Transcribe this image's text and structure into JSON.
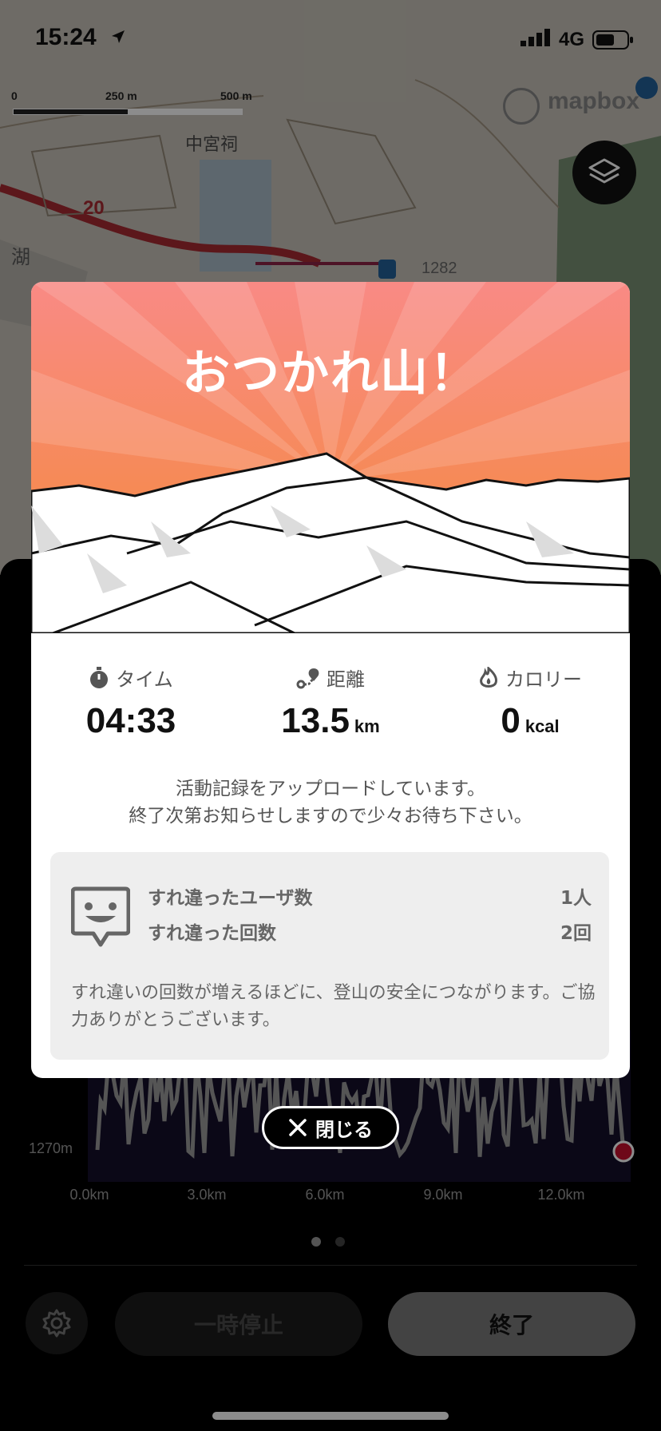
{
  "status_bar": {
    "time": "15:24",
    "network": "4G"
  },
  "map": {
    "scale_labels": [
      "0",
      "250 m",
      "500 m"
    ],
    "attribution": "mapbox",
    "route_number": "20",
    "place_label": "中宮祠",
    "lake_label": "湖",
    "elevation_label": "1282"
  },
  "modal": {
    "title": "おつかれ山！",
    "stats": {
      "time": {
        "label": "タイム",
        "value": "04:33",
        "unit": ""
      },
      "distance": {
        "label": "距離",
        "value": "13.5",
        "unit": "km"
      },
      "calories": {
        "label": "カロリー",
        "value": "0",
        "unit": "kcal"
      }
    },
    "upload_message_line1": "活動記録をアップロードしています。",
    "upload_message_line2": "終了次第お知らせしますので少々お待ち下さい。",
    "passing": {
      "users_label": "すれ違ったユーザ数",
      "users_value": "1人",
      "count_label": "すれ違った回数",
      "count_value": "2回",
      "note": "すれ違いの回数が増えるほどに、登山の安全につながります。ご協力ありがとうございます。"
    },
    "close_label": "閉じる"
  },
  "elevation_chart": {
    "y_label": "1270m",
    "x_labels": [
      "0.0km",
      "3.0km",
      "6.0km",
      "9.0km",
      "12.0km"
    ]
  },
  "controls": {
    "pause_label": "一時停止",
    "end_label": "終了"
  }
}
